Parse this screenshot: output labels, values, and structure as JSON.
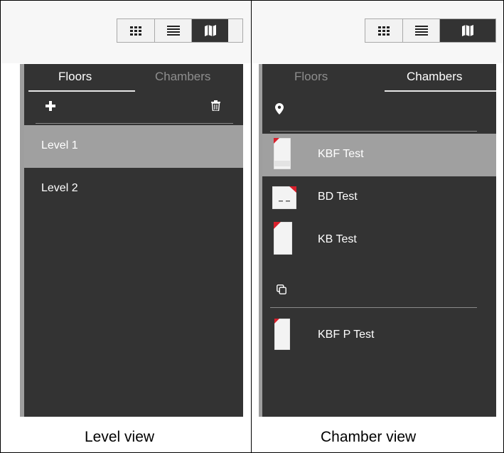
{
  "level_view": {
    "view_toggle": {
      "icons": [
        "grid-icon",
        "list-icon",
        "map-icon"
      ],
      "active": "map-icon"
    },
    "tabs": [
      {
        "label": "Floors",
        "active": true
      },
      {
        "label": "Chambers",
        "active": false
      }
    ],
    "toolbar": {
      "left_icon": "plus-icon",
      "right_icon": "trash-icon"
    },
    "items": [
      {
        "label": "Level 1",
        "selected": true
      },
      {
        "label": "Level 2",
        "selected": false
      }
    ],
    "caption": "Level view"
  },
  "chamber_view": {
    "view_toggle": {
      "icons": [
        "grid-icon",
        "list-icon",
        "map-icon"
      ],
      "active": "map-icon"
    },
    "tabs": [
      {
        "label": "Floors",
        "active": false
      },
      {
        "label": "Chambers",
        "active": true
      }
    ],
    "located_section_icon": "location-pin-icon",
    "located_items": [
      {
        "label": "KBF Test",
        "selected": true,
        "thumb": "tall-cabinet"
      },
      {
        "label": "BD Test",
        "selected": false,
        "thumb": "wide-cabinet"
      },
      {
        "label": "KB Test",
        "selected": false,
        "thumb": "tall-cabinet"
      }
    ],
    "unplaced_section_icon": "copy-icon",
    "unplaced_items": [
      {
        "label": "KBF P Test",
        "selected": false,
        "thumb": "tall-cabinet"
      }
    ],
    "caption": "Chamber view"
  },
  "colors": {
    "sidebar_bg": "#333333",
    "selected_bg": "#a0a0a0",
    "accent_red": "#d9202c",
    "active_toggle": "#333333"
  }
}
